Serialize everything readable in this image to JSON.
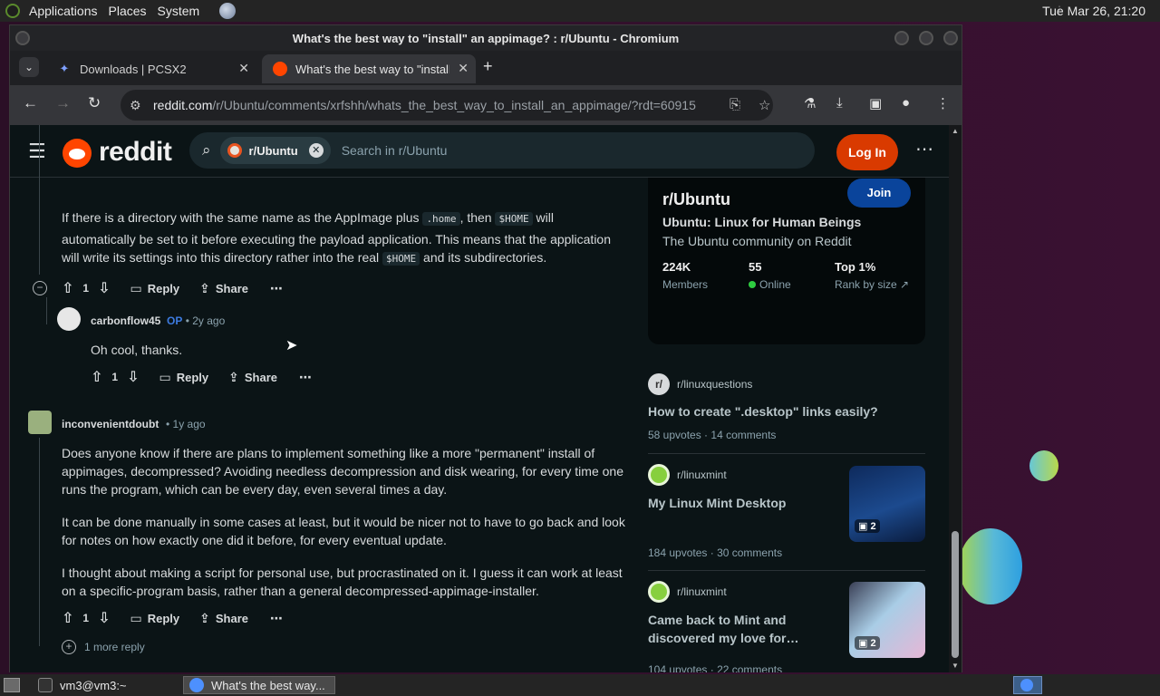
{
  "top_panel": {
    "menus": [
      "Applications",
      "Places",
      "System"
    ],
    "clock": "Tue Mar 26, 21:20"
  },
  "window": {
    "title": "What's the best way to \"install\" an appimage? : r/Ubuntu - Chromium"
  },
  "tabs": [
    {
      "label": "Downloads | PCSX2"
    },
    {
      "label": "What's the best way to \"install\" an appimage?"
    }
  ],
  "toolbar": {
    "url_host": "reddit.com",
    "url_path": "/r/Ubuntu/comments/xrfshh/whats_the_best_way_to_install_an_appimage/?rdt=60915"
  },
  "header": {
    "logo_text": "reddit",
    "chip_label": "r/Ubuntu",
    "search_placeholder": "Search in r/Ubuntu",
    "login_label": "Log In",
    "more_label": "⋯"
  },
  "comments": {
    "c1": {
      "p1_a": "If there is a directory with the same name as the AppImage plus",
      "code1": ".home",
      "p1_b": ", then",
      "code2": "$HOME",
      "p1_c": "will",
      "p1_line2": "automatically be set to it before executing the payload application. This means that the application",
      "p1_line3_a": "will write its settings into this directory rather into the real",
      "code3": "$HOME",
      "p1_line3_b": "and its subdirectories.",
      "votes": "1"
    },
    "c2": {
      "user": "carbonflow45",
      "op": "OP",
      "age": "• 2y ago",
      "text": "Oh cool, thanks.",
      "votes": "1"
    },
    "c3": {
      "user": "inconvenientdoubt",
      "age": "• 1y ago",
      "p1_l1": "Does anyone know if there are plans to implement something like a more \"permanent\" install of",
      "p1_l2": "appimages, decompressed? Avoiding needless decompression and disk wearing, for every time one",
      "p1_l3": "runs the program, which can be every day, even several times a day.",
      "p2_l1": "It can be done manually in some cases at least, but it would be nicer not to have to go back and look",
      "p2_l2": "for notes on how exactly one did it before, for every eventual update.",
      "p3_l1": "I thought about making a script for personal use, but procrastinated on it. I guess it can work at least",
      "p3_l2": "on a specific-program basis, rather than a general decompressed-appimage-installer.",
      "votes": "1",
      "more_replies": "1 more reply"
    },
    "actions": {
      "reply": "Reply",
      "share": "Share",
      "more": "⋯"
    }
  },
  "sidebar": {
    "community": {
      "name": "r/Ubuntu",
      "join_label": "Join",
      "subtitle": "Ubuntu: Linux for Human Beings",
      "description": "The Ubuntu community on Reddit",
      "members_value": "224K",
      "members_label": "Members",
      "online_value": "55",
      "online_label": "Online",
      "rank_value": "Top 1%",
      "rank_label": "Rank by size"
    },
    "posts": [
      {
        "sub": "r/linuxquestions",
        "title": "How to create \".desktop\" links easily?",
        "upvotes": "58 upvotes",
        "comments": "14 comments"
      },
      {
        "sub": "r/linuxmint",
        "title": "My Linux Mint Desktop",
        "upvotes": "184 upvotes",
        "comments": "30 comments",
        "badge": "2"
      },
      {
        "sub": "r/linuxmint",
        "title_l1": "Came back to Mint and",
        "title_l2": "discovered my love for…",
        "upvotes": "104 upvotes",
        "comments": "22 comments",
        "badge": "2"
      }
    ]
  },
  "taskbar": {
    "items": [
      {
        "label": "vm3@vm3:~"
      },
      {
        "label": "What's the best way..."
      }
    ]
  },
  "colors": {
    "reddit_orange": "#ff4500",
    "login_bg": "#d93a00",
    "join_bg": "#0a449b",
    "page_bg": "#0b1416"
  }
}
